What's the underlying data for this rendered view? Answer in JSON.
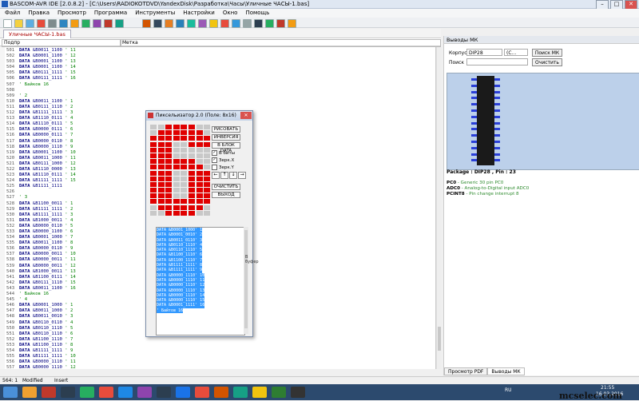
{
  "window": {
    "title": "BASCOM-AVR IDE [2.0.8.2] - [C:\\Users\\RADIOKOTDVD\\YandexDisk\\Разработка\\Часы\\Уличные ЧАСЫ-1.bas]"
  },
  "menu": [
    "Файл",
    "Правка",
    "Просмотр",
    "Программа",
    "Инструменты",
    "Настройки",
    "Окно",
    "Помощь"
  ],
  "file_tab": "Уличные ЧАСЫ-1.bas",
  "sub_dropdown": "Подпр",
  "label_dropdown": "Метка",
  "code_lines": [
    {
      "n": "501",
      "kind": "data",
      "bin": "&B0011_1100",
      "c": "' 11"
    },
    {
      "n": "502",
      "kind": "data",
      "bin": "&B0001_1100",
      "c": "' 12"
    },
    {
      "n": "503",
      "kind": "data",
      "bin": "&B0001_1100",
      "c": "' 13"
    },
    {
      "n": "504",
      "kind": "data",
      "bin": "&B0001_1100",
      "c": "' 14"
    },
    {
      "n": "505",
      "kind": "data",
      "bin": "&B0111_1111",
      "c": "' 15"
    },
    {
      "n": "506",
      "kind": "data",
      "bin": "&B0111_1111",
      "c": "' 16"
    },
    {
      "n": "507",
      "kind": "comment",
      "c": "' Байков 16"
    },
    {
      "n": "508",
      "kind": "blank"
    },
    {
      "n": "509",
      "kind": "comment",
      "c": "' 2"
    },
    {
      "n": "510",
      "kind": "data",
      "bin": "&B0011_1100",
      "c": "' 1"
    },
    {
      "n": "511",
      "kind": "data",
      "bin": "&B0111_1110",
      "c": "' 2"
    },
    {
      "n": "512",
      "kind": "data",
      "bin": "&B1111_1111",
      "c": "' 3"
    },
    {
      "n": "513",
      "kind": "data",
      "bin": "&B1110_0111",
      "c": "' 4"
    },
    {
      "n": "514",
      "kind": "data",
      "bin": "&B1110_0111",
      "c": "' 5"
    },
    {
      "n": "515",
      "kind": "data",
      "bin": "&B0000_0111",
      "c": "' 6"
    },
    {
      "n": "516",
      "kind": "data",
      "bin": "&B0000_0111",
      "c": "' 7"
    },
    {
      "n": "517",
      "kind": "data",
      "bin": "&B0000_0110",
      "c": "' 8"
    },
    {
      "n": "518",
      "kind": "data",
      "bin": "&B0000_1110",
      "c": "' 9"
    },
    {
      "n": "519",
      "kind": "data",
      "bin": "&B0001_1100",
      "c": "' 10"
    },
    {
      "n": "520",
      "kind": "data",
      "bin": "&B0011_1000",
      "c": "' 11"
    },
    {
      "n": "521",
      "kind": "data",
      "bin": "&B0111_1000",
      "c": "' 12"
    },
    {
      "n": "522",
      "kind": "data",
      "bin": "&B1110_0000",
      "c": "' 13"
    },
    {
      "n": "523",
      "kind": "data",
      "bin": "&B1110_0111",
      "c": "' 14"
    },
    {
      "n": "524",
      "kind": "data",
      "bin": "&B1111_1111",
      "c": "' 15"
    },
    {
      "n": "525",
      "kind": "data",
      "bin": "&B1111_1111",
      "c": ""
    },
    {
      "n": "526",
      "kind": "blank"
    },
    {
      "n": "527",
      "kind": "comment",
      "c": "' 3"
    },
    {
      "n": "528",
      "kind": "data",
      "bin": "&B1100_0011",
      "c": "' 1"
    },
    {
      "n": "529",
      "kind": "data",
      "bin": "&B1111_1111",
      "c": "' 2"
    },
    {
      "n": "530",
      "kind": "data",
      "bin": "&B1111_1111",
      "c": "' 3"
    },
    {
      "n": "531",
      "kind": "data",
      "bin": "&B1000_0011",
      "c": "' 4"
    },
    {
      "n": "532",
      "kind": "data",
      "bin": "&B0000_0110",
      "c": "' 5"
    },
    {
      "n": "533",
      "kind": "data",
      "bin": "&B0000_1100",
      "c": "' 6"
    },
    {
      "n": "534",
      "kind": "data",
      "bin": "&B0001_1000",
      "c": "' 7"
    },
    {
      "n": "535",
      "kind": "data",
      "bin": "&B0011_1100",
      "c": "' 8"
    },
    {
      "n": "536",
      "kind": "data",
      "bin": "&B0000_0110",
      "c": "' 9"
    },
    {
      "n": "537",
      "kind": "data",
      "bin": "&B0000_0011",
      "c": "' 10"
    },
    {
      "n": "538",
      "kind": "data",
      "bin": "&B0000_0011",
      "c": "' 11"
    },
    {
      "n": "539",
      "kind": "data",
      "bin": "&B0000_0011",
      "c": "' 12"
    },
    {
      "n": "540",
      "kind": "data",
      "bin": "&B1000_0011",
      "c": "' 13"
    },
    {
      "n": "541",
      "kind": "data",
      "bin": "&B1100_0111",
      "c": "' 14"
    },
    {
      "n": "542",
      "kind": "data",
      "bin": "&B0111_1110",
      "c": "' 15"
    },
    {
      "n": "543",
      "kind": "data",
      "bin": "&B0011_1100",
      "c": "' 16"
    },
    {
      "n": "544",
      "kind": "comment",
      "c": "' Байков 16"
    },
    {
      "n": "545",
      "kind": "comment",
      "c": "' 4"
    },
    {
      "n": "546",
      "kind": "data",
      "bin": "&B0001_1000",
      "c": "' 1"
    },
    {
      "n": "547",
      "kind": "data",
      "bin": "&B0011_1000",
      "c": "' 2"
    },
    {
      "n": "548",
      "kind": "data",
      "bin": "&B0011_0010",
      "c": "' 3"
    },
    {
      "n": "549",
      "kind": "data",
      "bin": "&B0110_0110",
      "c": "' 4"
    },
    {
      "n": "550",
      "kind": "data",
      "bin": "&B0110_1110",
      "c": "' 5"
    },
    {
      "n": "551",
      "kind": "data",
      "bin": "&B0110_1110",
      "c": "' 6"
    },
    {
      "n": "552",
      "kind": "data",
      "bin": "&B1100_1110",
      "c": "' 7"
    },
    {
      "n": "553",
      "kind": "data",
      "bin": "&B1100_1110",
      "c": "' 8"
    },
    {
      "n": "554",
      "kind": "data",
      "bin": "&B1111_1111",
      "c": "' 9"
    },
    {
      "n": "555",
      "kind": "data",
      "bin": "&B1111_1111",
      "c": "' 10"
    },
    {
      "n": "556",
      "kind": "data",
      "bin": "&B0000_1110",
      "c": "' 11"
    },
    {
      "n": "557",
      "kind": "data",
      "bin": "&B0000_1110",
      "c": "' 12"
    },
    {
      "n": "558",
      "kind": "data",
      "bin": "&B0000_1110",
      "c": "' 13"
    },
    {
      "n": "559",
      "kind": "data",
      "bin": "&B0000_1110",
      "c": "' 14"
    },
    {
      "n": "560",
      "kind": "data",
      "bin": "&B0000_1110",
      "c": "' 15"
    },
    {
      "n": "561",
      "kind": "data",
      "bin": "&B0001_1111",
      "c": "' 16"
    },
    {
      "n": "562",
      "kind": "comment",
      "c": "' Байков 16"
    },
    {
      "n": "563",
      "kind": "blank"
    },
    {
      "n": "564",
      "kind": "blank"
    },
    {
      "n": "565",
      "kind": "blank"
    }
  ],
  "pixel_dialog": {
    "title": "Пиксельизатор 2.0 (Поле: 8x16)",
    "buttons": {
      "draw": "РИСОВАТЬ",
      "invert": "ИНВЕРСИЯ",
      "to_block": "В БЛОК DATA",
      "clear": "ОЧИСТИТЬ",
      "exit": "ВЫХОД"
    },
    "checks": [
      {
        "label": "В биты",
        "checked": true
      },
      {
        "label": "Зерк.X",
        "checked": true
      },
      {
        "label": "Зерк.Y",
        "checked": false
      }
    ],
    "arrows": [
      "←",
      "↑",
      "↓",
      "→"
    ],
    "vertical_label": "В буфер",
    "grid_rows": [
      "00111100",
      "01111110",
      "11111111",
      "11100111",
      "11100000",
      "11100000",
      "11111100",
      "11111110",
      "11100111",
      "11100111",
      "11100111",
      "11100111",
      "11100111",
      "11111111",
      "01111110",
      "00111100"
    ],
    "output_lines": [
      "DATA &B0001_1000' 1",
      "DATA &B0001_0010' 2",
      "DATA &B0011_0110' 3",
      "DATA &B0110_1110' 4",
      "DATA &B0110_1110' 5",
      "DATA &B1100_1110' 6",
      "DATA &B1100_1110' 7",
      "DATA &B1111_1111' 8",
      "DATA &B1111_1111' 9",
      "DATA &B0000_1110' 10",
      "DATA &B0000_1110' 11",
      "DATA &B0000_1110' 12",
      "DATA &B0000_1110' 13",
      "DATA &B0000_1110' 14",
      "DATA &B0000_1110' 15",
      "DATA &B0001_1111' 16",
      "' Байтов 16"
    ]
  },
  "right_panel": {
    "title": "Выводы МК",
    "case_label": "Корпус",
    "case_value": "DIP28",
    "case_value2": "(C...",
    "find_mk_button": "Поиск МК",
    "search_label": "Поиск",
    "clear_button": "Очистить",
    "package_line": "Package : DIP28 , Pin : 23",
    "pins": [
      {
        "name": "PC0",
        "desc": " - Generic 30 pin PC0"
      },
      {
        "name": "ADC0",
        "desc": " - Analog-to-Digital input ADC0"
      },
      {
        "name": "PCINT8",
        "desc": " - Pin change interrupt 8"
      }
    ],
    "tabs": [
      "Просмотр PDF",
      "Выводы МК"
    ]
  },
  "statusbar": {
    "pos": "564: 1",
    "modified": "Modified",
    "insert": "Insert"
  },
  "tray": {
    "lang": "RU",
    "time": "21:55",
    "date": "16.03.2016"
  },
  "watermark": "mcselec.com",
  "colors": {
    "pixel_on": "#e00000",
    "pixel_off": "#c8c8c8",
    "selection": "#3399ff"
  }
}
